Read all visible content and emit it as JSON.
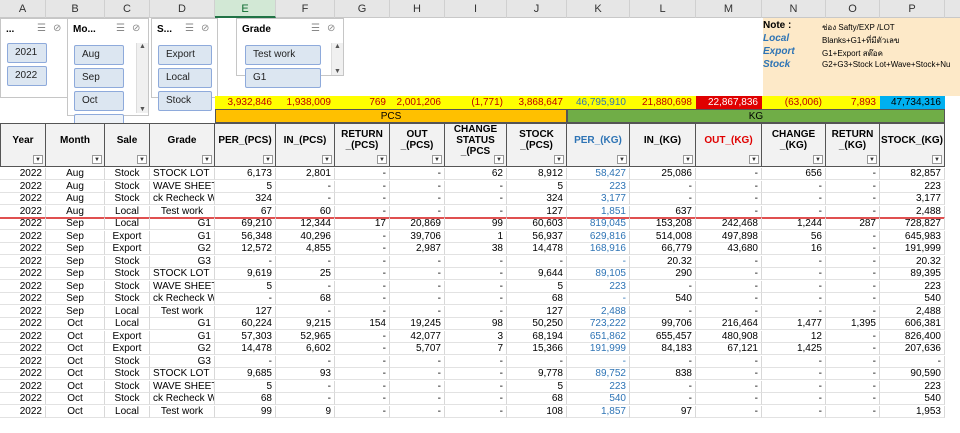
{
  "columns": [
    "A",
    "B",
    "C",
    "D",
    "E",
    "F",
    "G",
    "H",
    "I",
    "J",
    "K",
    "L",
    "M",
    "N",
    "O",
    "P"
  ],
  "selected_column": "E",
  "slicers": [
    {
      "title": "...",
      "items": [
        "2021",
        "2022"
      ]
    },
    {
      "title": "Mo...",
      "items": [
        "Aug",
        "Sep",
        "Oct",
        ""
      ]
    },
    {
      "title": "S...",
      "items": [
        "Export",
        "Local",
        "Stock"
      ]
    },
    {
      "title": "Grade",
      "items": [
        "Test work",
        "G1"
      ]
    }
  ],
  "note": {
    "rows": [
      {
        "label": "Note :",
        "value": "ช่อง Safty/EXP /LOT"
      },
      {
        "label": "Local",
        "value": "Blanks+G1+ที่มีตัวเลข"
      },
      {
        "label": "Export",
        "value": "G1+Export สต๊อค"
      },
      {
        "label": "Stock",
        "value": "G2+G3+Stock Lot+Wave+Stock+Nu"
      }
    ]
  },
  "totals": [
    "3,932,846",
    "1,938,009",
    "769",
    "2,001,206",
    "(1,771)",
    "3,868,647",
    "46,795,910",
    "21,880,698",
    "22,867,836",
    "(63,006)",
    "7,893",
    "47,734,316"
  ],
  "bands": {
    "pcs": "PCS",
    "kg": "KG"
  },
  "headers": [
    "Year",
    "Month",
    "Sale",
    "Grade",
    "PER_(PCS)",
    "IN_(PCS)",
    "RETURN _(PCS)",
    "OUT _(PCS)",
    "CHANGE STATUS _(PCS",
    "STOCK _(PCS)",
    "PER_(KG)",
    "IN_(KG)",
    "OUT_(KG)",
    "CHANGE _(KG)",
    "RETURN _(KG)",
    "STOCK_(KG)"
  ],
  "rows": [
    [
      "2022",
      "Aug",
      "Stock",
      "STOCK LOT",
      "6,173",
      "2,801",
      "-",
      "-",
      "62",
      "8,912",
      "58,427",
      "25,086",
      "-",
      "656",
      "-",
      "82,857"
    ],
    [
      "2022",
      "Aug",
      "Stock",
      "WAVE SHEET",
      "5",
      "-",
      "-",
      "-",
      "-",
      "5",
      "223",
      "-",
      "-",
      "-",
      "-",
      "223"
    ],
    [
      "2022",
      "Aug",
      "Stock",
      "ck Recheck W",
      "324",
      "-",
      "-",
      "-",
      "-",
      "324",
      "3,177",
      "-",
      "-",
      "-",
      "-",
      "3,177"
    ],
    [
      "2022",
      "Aug",
      "Local",
      "Test work",
      "67",
      "60",
      "-",
      "-",
      "-",
      "127",
      "1,851",
      "637",
      "-",
      "-",
      "-",
      "2,488"
    ],
    [
      "2022",
      "Sep",
      "Local",
      "G1",
      "69,210",
      "12,344",
      "17",
      "20,869",
      "99",
      "60,603",
      "819,045",
      "153,208",
      "242,468",
      "1,244",
      "287",
      "728,827"
    ],
    [
      "2022",
      "Sep",
      "Export",
      "G1",
      "56,348",
      "40,296",
      "-",
      "39,706",
      "1",
      "56,937",
      "629,816",
      "514,008",
      "497,898",
      "56",
      "-",
      "645,983"
    ],
    [
      "2022",
      "Sep",
      "Export",
      "G2",
      "12,572",
      "4,855",
      "-",
      "2,987",
      "38",
      "14,478",
      "168,916",
      "66,779",
      "43,680",
      "16",
      "-",
      "191,999"
    ],
    [
      "2022",
      "Sep",
      "Stock",
      "G3",
      "-",
      "-",
      "-",
      "-",
      "-",
      "-",
      "-",
      "20.32",
      "-",
      "-",
      "-",
      "20.32"
    ],
    [
      "2022",
      "Sep",
      "Stock",
      "STOCK LOT",
      "9,619",
      "25",
      "-",
      "-",
      "-",
      "9,644",
      "89,105",
      "290",
      "-",
      "-",
      "-",
      "89,395"
    ],
    [
      "2022",
      "Sep",
      "Stock",
      "WAVE SHEET",
      "5",
      "-",
      "-",
      "-",
      "-",
      "5",
      "223",
      "-",
      "-",
      "-",
      "-",
      "223"
    ],
    [
      "2022",
      "Sep",
      "Stock",
      "ck Recheck W",
      "-",
      "68",
      "-",
      "-",
      "-",
      "68",
      "-",
      "540",
      "-",
      "-",
      "-",
      "540"
    ],
    [
      "2022",
      "Sep",
      "Local",
      "Test work",
      "127",
      "-",
      "-",
      "-",
      "-",
      "127",
      "2,488",
      "-",
      "-",
      "-",
      "-",
      "2,488"
    ],
    [
      "2022",
      "Oct",
      "Local",
      "G1",
      "60,224",
      "9,215",
      "154",
      "19,245",
      "98",
      "50,250",
      "723,222",
      "99,706",
      "216,464",
      "1,477",
      "1,395",
      "606,381"
    ],
    [
      "2022",
      "Oct",
      "Export",
      "G1",
      "57,303",
      "52,965",
      "-",
      "42,077",
      "3",
      "68,194",
      "651,862",
      "655,457",
      "480,908",
      "12",
      "-",
      "826,400"
    ],
    [
      "2022",
      "Oct",
      "Export",
      "G2",
      "14,478",
      "6,602",
      "-",
      "5,707",
      "7",
      "15,366",
      "191,999",
      "84,183",
      "67,121",
      "1,425",
      "-",
      "207,636"
    ],
    [
      "2022",
      "Oct",
      "Stock",
      "G3",
      "-",
      "-",
      "-",
      "-",
      "-",
      "-",
      "-",
      "-",
      "-",
      "-",
      "-",
      "-"
    ],
    [
      "2022",
      "Oct",
      "Stock",
      "STOCK LOT",
      "9,685",
      "93",
      "-",
      "-",
      "-",
      "9,778",
      "89,752",
      "838",
      "-",
      "-",
      "-",
      "90,590"
    ],
    [
      "2022",
      "Oct",
      "Stock",
      "WAVE SHEET",
      "5",
      "-",
      "-",
      "-",
      "-",
      "5",
      "223",
      "-",
      "-",
      "-",
      "-",
      "223"
    ],
    [
      "2022",
      "Oct",
      "Stock",
      "ck Recheck W",
      "68",
      "-",
      "-",
      "-",
      "-",
      "68",
      "540",
      "-",
      "-",
      "-",
      "-",
      "540"
    ],
    [
      "2022",
      "Oct",
      "Local",
      "Test work",
      "99",
      "9",
      "-",
      "-",
      "-",
      "108",
      "1,857",
      "97",
      "-",
      "-",
      "-",
      "1,953"
    ]
  ],
  "colors": {
    "yellow": "#ffff00",
    "red": "#e00000",
    "blue_total": "#00b0f0",
    "green_band": "#70ad47",
    "orange_band": "#ffc000",
    "kg_text": "#2e74b5",
    "out_kg": "#e00000"
  }
}
